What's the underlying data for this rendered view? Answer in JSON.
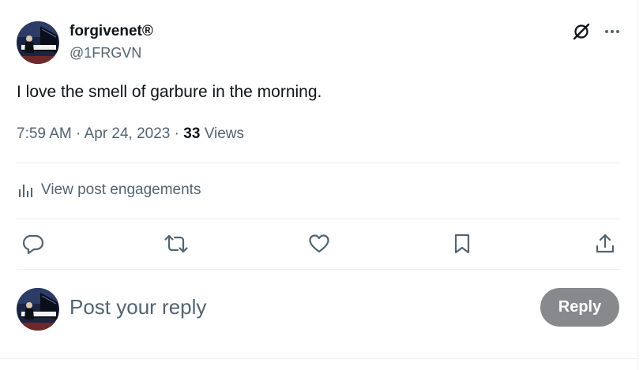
{
  "author": {
    "name": "forgivenet",
    "badge": "®",
    "handle": "@1FRGVN",
    "avatar_icon": "avatar-pianist-image"
  },
  "post": {
    "text": "I love the smell of garbure in the morning.",
    "time": "7:59 AM",
    "separator": "·",
    "date": "Apr 24, 2023",
    "views_count": "33",
    "views_label": "Views"
  },
  "header_icons": {
    "grok": "grok-icon",
    "more": "more-dots-icon"
  },
  "engagements": {
    "label": "View post engagements",
    "icon": "analytics-bars-icon"
  },
  "actions": [
    {
      "name": "reply",
      "icon": "reply-bubble-icon"
    },
    {
      "name": "repost",
      "icon": "repost-icon"
    },
    {
      "name": "like",
      "icon": "heart-icon"
    },
    {
      "name": "bookmark",
      "icon": "bookmark-icon"
    },
    {
      "name": "share",
      "icon": "share-icon"
    }
  ],
  "reply_box": {
    "placeholder": "Post your reply",
    "button_label": "Reply"
  },
  "colors": {
    "text_primary": "#0f1419",
    "text_secondary": "#536471",
    "divider": "#eff3f4",
    "reply_button_disabled": "#87898c"
  }
}
